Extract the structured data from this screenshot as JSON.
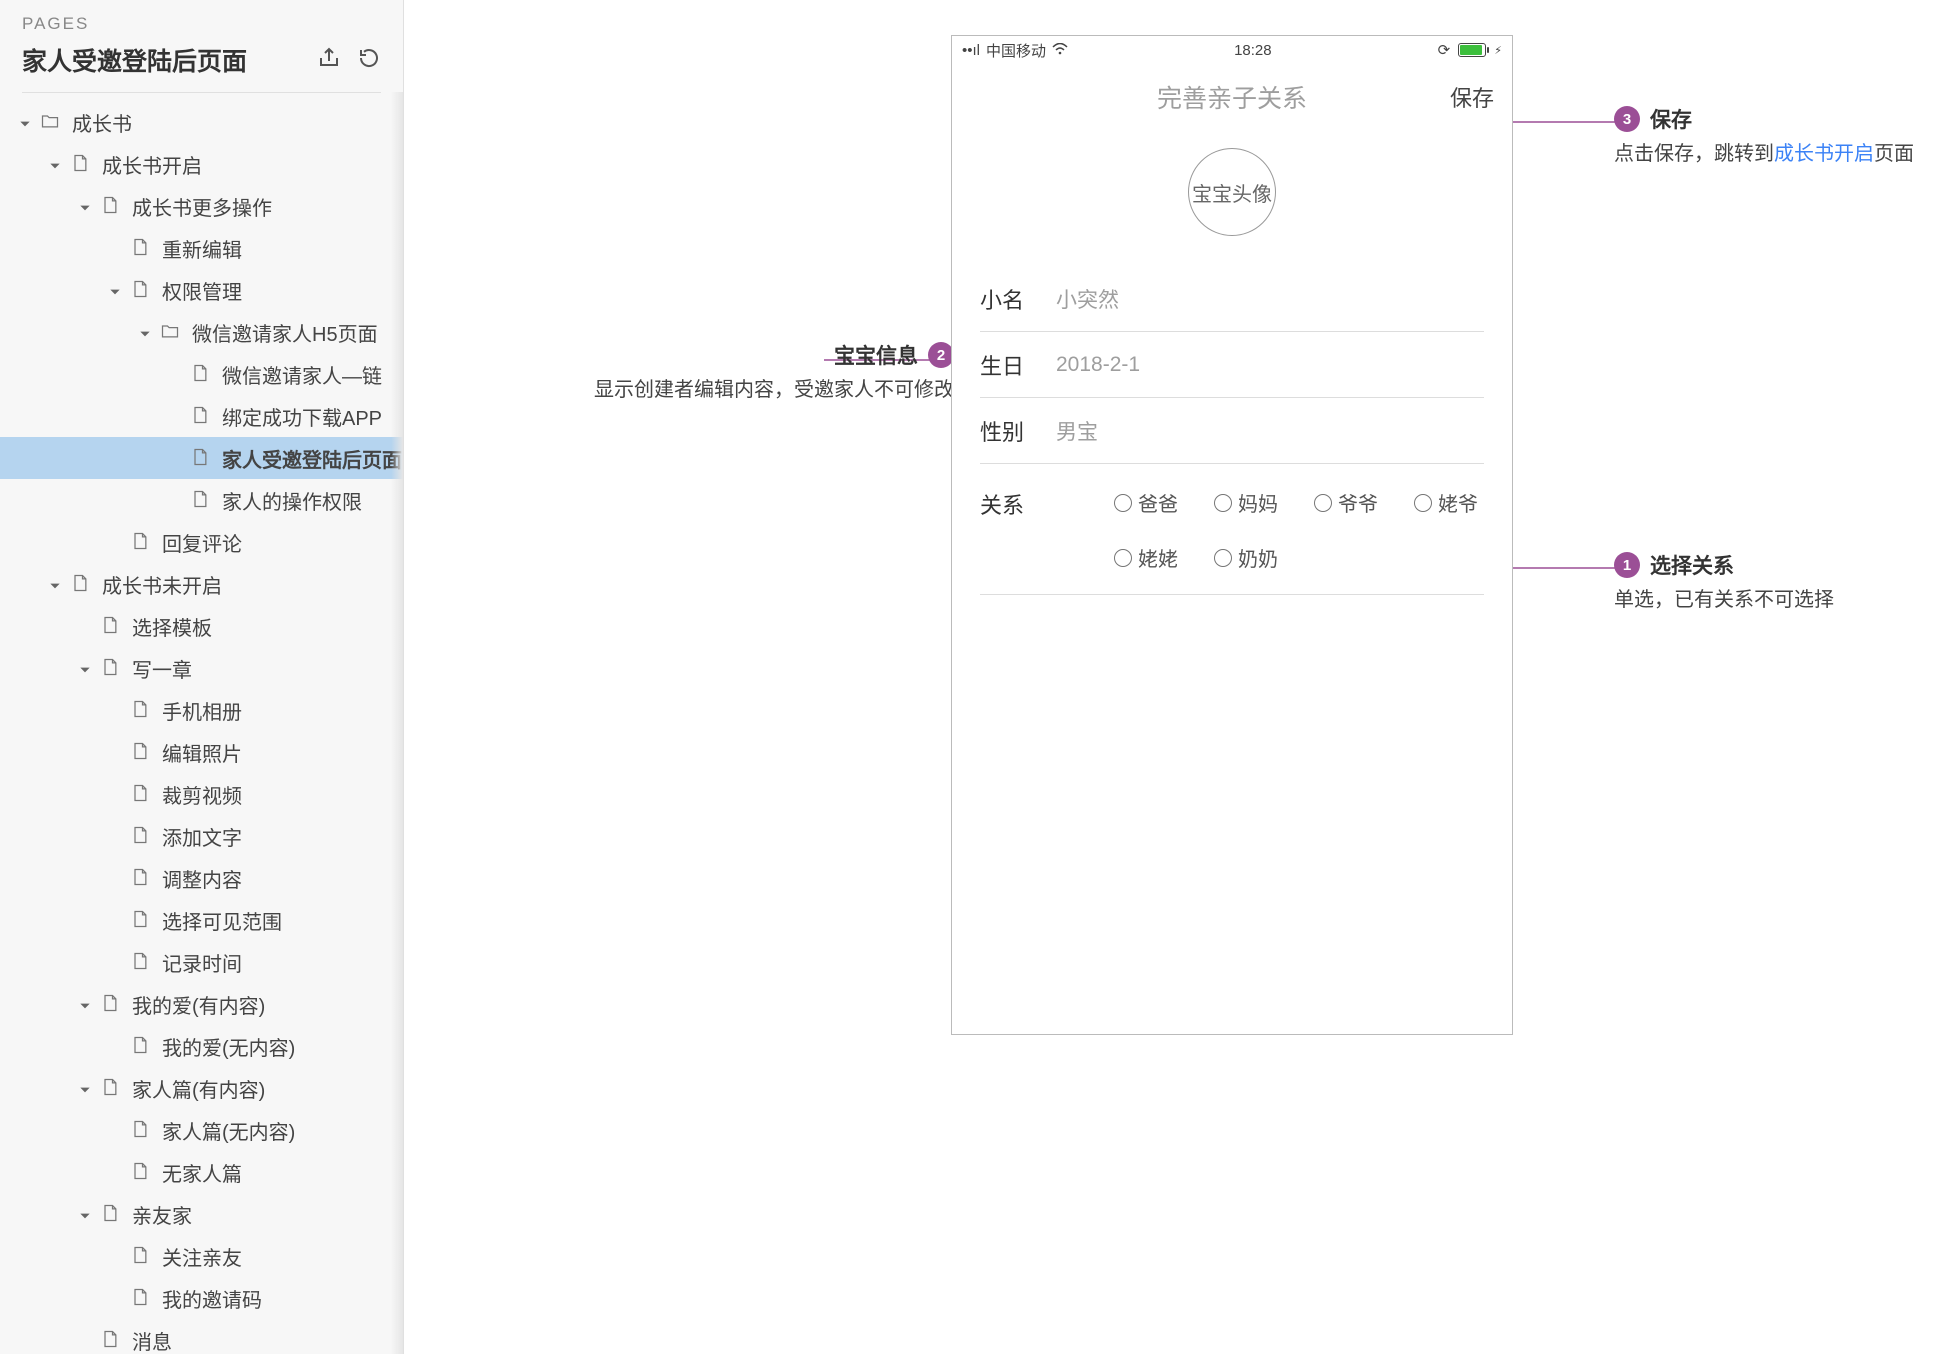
{
  "sidebar": {
    "section_label": "PAGES",
    "title": "家人受邀登陆后页面",
    "tree": [
      {
        "d": 0,
        "caret": "down",
        "icon": "folder",
        "label": "成长书",
        "sel": false
      },
      {
        "d": 1,
        "caret": "down",
        "icon": "doc",
        "label": "成长书开启",
        "sel": false
      },
      {
        "d": 2,
        "caret": "down",
        "icon": "doc",
        "label": "成长书更多操作",
        "sel": false
      },
      {
        "d": 3,
        "caret": "",
        "icon": "doc",
        "label": "重新编辑",
        "sel": false
      },
      {
        "d": 3,
        "caret": "down",
        "icon": "doc",
        "label": "权限管理",
        "sel": false
      },
      {
        "d": 4,
        "caret": "down",
        "icon": "folder",
        "label": "微信邀请家人H5页面",
        "sel": false
      },
      {
        "d": 5,
        "caret": "",
        "icon": "doc",
        "label": "微信邀请家人—链",
        "sel": false
      },
      {
        "d": 5,
        "caret": "",
        "icon": "doc",
        "label": "绑定成功下载APP",
        "sel": false
      },
      {
        "d": 5,
        "caret": "",
        "icon": "doc",
        "label": "家人受邀登陆后页面",
        "sel": true
      },
      {
        "d": 5,
        "caret": "",
        "icon": "doc",
        "label": "家人的操作权限",
        "sel": false
      },
      {
        "d": 3,
        "caret": "",
        "icon": "doc",
        "label": "回复评论",
        "sel": false
      },
      {
        "d": 1,
        "caret": "down",
        "icon": "doc",
        "label": "成长书未开启",
        "sel": false
      },
      {
        "d": 2,
        "caret": "",
        "icon": "doc",
        "label": "选择模板",
        "sel": false
      },
      {
        "d": 2,
        "caret": "down",
        "icon": "doc",
        "label": "写一章",
        "sel": false
      },
      {
        "d": 3,
        "caret": "",
        "icon": "doc",
        "label": "手机相册",
        "sel": false
      },
      {
        "d": 3,
        "caret": "",
        "icon": "doc",
        "label": "编辑照片",
        "sel": false
      },
      {
        "d": 3,
        "caret": "",
        "icon": "doc",
        "label": "裁剪视频",
        "sel": false
      },
      {
        "d": 3,
        "caret": "",
        "icon": "doc",
        "label": "添加文字",
        "sel": false
      },
      {
        "d": 3,
        "caret": "",
        "icon": "doc",
        "label": "调整内容",
        "sel": false
      },
      {
        "d": 3,
        "caret": "",
        "icon": "doc",
        "label": "选择可见范围",
        "sel": false
      },
      {
        "d": 3,
        "caret": "",
        "icon": "doc",
        "label": "记录时间",
        "sel": false
      },
      {
        "d": 2,
        "caret": "down",
        "icon": "doc",
        "label": "我的爱(有内容)",
        "sel": false
      },
      {
        "d": 3,
        "caret": "",
        "icon": "doc",
        "label": "我的爱(无内容)",
        "sel": false
      },
      {
        "d": 2,
        "caret": "down",
        "icon": "doc",
        "label": "家人篇(有内容)",
        "sel": false
      },
      {
        "d": 3,
        "caret": "",
        "icon": "doc",
        "label": "家人篇(无内容)",
        "sel": false
      },
      {
        "d": 3,
        "caret": "",
        "icon": "doc",
        "label": "无家人篇",
        "sel": false
      },
      {
        "d": 2,
        "caret": "down",
        "icon": "doc",
        "label": "亲友家",
        "sel": false
      },
      {
        "d": 3,
        "caret": "",
        "icon": "doc",
        "label": "关注亲友",
        "sel": false
      },
      {
        "d": 3,
        "caret": "",
        "icon": "doc",
        "label": "我的邀请码",
        "sel": false
      },
      {
        "d": 2,
        "caret": "",
        "icon": "doc",
        "label": "消息",
        "sel": false
      }
    ]
  },
  "phone": {
    "statusbar": {
      "carrier_icons": "📶",
      "carrier": "中国移动",
      "wifi": "wifi",
      "time": "18:28",
      "spin": "◌",
      "batt_bolt": "⚡︎"
    },
    "navbar": {
      "title": "完善亲子关系",
      "save": "保存"
    },
    "avatar_label": "宝宝头像",
    "fields": {
      "nickname_label": "小名",
      "nickname_value": "小突然",
      "birthday_label": "生日",
      "birthday_value": "2018-2-1",
      "gender_label": "性别",
      "gender_value": "男宝",
      "relation_label": "关系",
      "relation_options": [
        "爸爸",
        "妈妈",
        "爷爷",
        "姥爷",
        "姥姥",
        "奶奶"
      ]
    }
  },
  "annotations": {
    "a1": {
      "num": "1",
      "title": "选择关系",
      "body": "单选，已有关系不可选择"
    },
    "a2": {
      "num": "2",
      "title": "宝宝信息",
      "body": "显示创建者编辑内容，受邀家人不可修改"
    },
    "a3": {
      "num": "3",
      "title": "保存",
      "body_pre": "点击保存，跳转到",
      "body_link": "成长书开启",
      "body_post": "页面"
    }
  }
}
